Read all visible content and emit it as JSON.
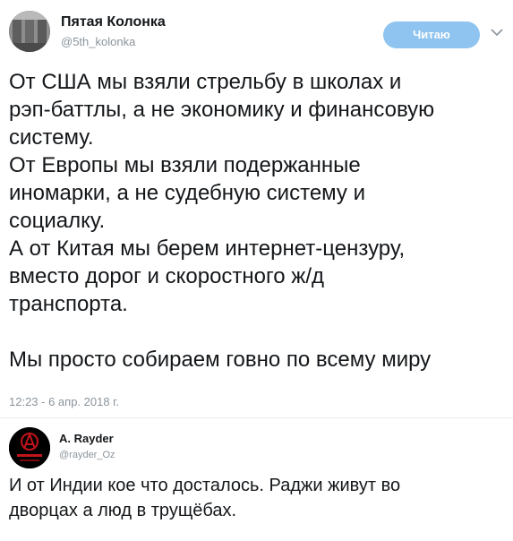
{
  "tweet": {
    "author": {
      "name": "Пятая Колонка",
      "handle": "@5th_kolonka"
    },
    "follow_label": "Читаю",
    "text_lines": [
      "От США мы взяли стрельбу в школах и",
      "рэп-баттлы, а не экономику и финансовую",
      "систему.",
      "От Европы мы взяли подержанные",
      "иномарки, а не судебную систему и",
      "социалку.",
      "А от Китая мы берем интернет-цензуру,",
      "вместо дорог и скоростного ж/д",
      "транспорта."
    ],
    "closing_line": "Мы просто собираем говно по всему миру",
    "timestamp": "12:23 - 6 апр. 2018 г."
  },
  "reply": {
    "author": {
      "name": "A. Rayder",
      "handle": "@rayder_Oz"
    },
    "text_lines": [
      "И от Индии кое что досталось. Раджи живут во",
      "дворцах а люд в трущёбах."
    ]
  },
  "colors": {
    "follow_button": "#8ec4ef",
    "muted_text": "#8a949c",
    "divider": "#e6ecf0"
  },
  "icons": {
    "chevron": "chevron-down-icon"
  }
}
